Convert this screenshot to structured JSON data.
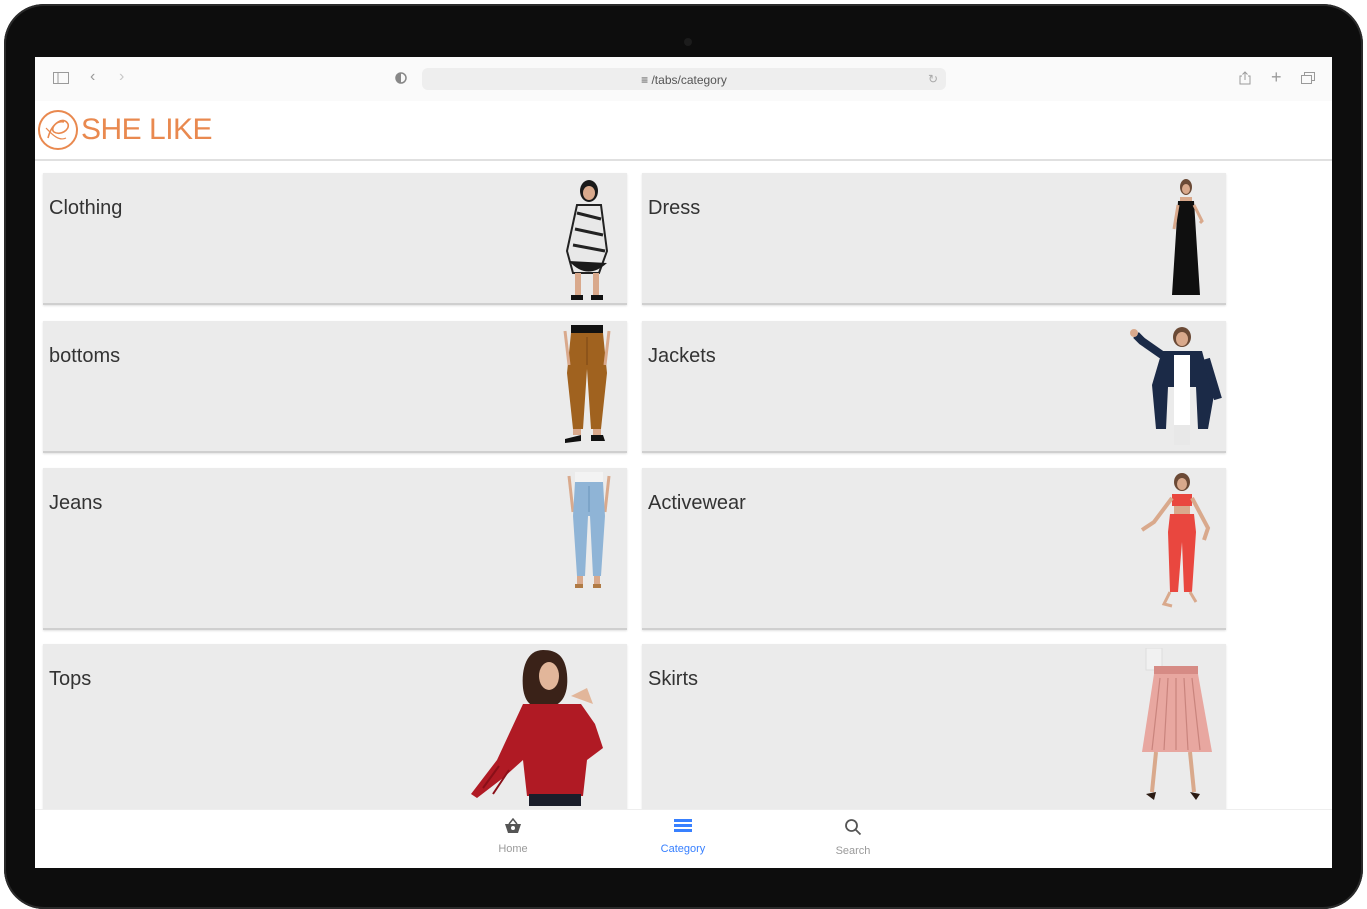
{
  "browser": {
    "url": "≡ /tabs/category"
  },
  "app": {
    "logo_text": "SHE LIKE",
    "brand_color": "#e9894f"
  },
  "categories": [
    {
      "label": "Clothing",
      "icon": "woman-in-black-white-outfit"
    },
    {
      "label": "Dress",
      "icon": "woman-in-black-jumpsuit"
    },
    {
      "label": "bottoms",
      "icon": "brown-trousers"
    },
    {
      "label": "Jackets",
      "icon": "woman-in-denim-jacket"
    },
    {
      "label": "Jeans",
      "icon": "light-blue-jeans"
    },
    {
      "label": "Activewear",
      "icon": "woman-in-red-activewear"
    },
    {
      "label": "Tops",
      "icon": "woman-in-red-top"
    },
    {
      "label": "Skirts",
      "icon": "pink-pleated-skirt"
    }
  ],
  "tabs": [
    {
      "label": "Home",
      "icon": "basket-icon",
      "active": false
    },
    {
      "label": "Category",
      "icon": "list-icon",
      "active": true
    },
    {
      "label": "Search",
      "icon": "search-icon",
      "active": false
    }
  ],
  "colors": {
    "card_bg": "#ebebeb",
    "active_tab": "#3880ff"
  }
}
